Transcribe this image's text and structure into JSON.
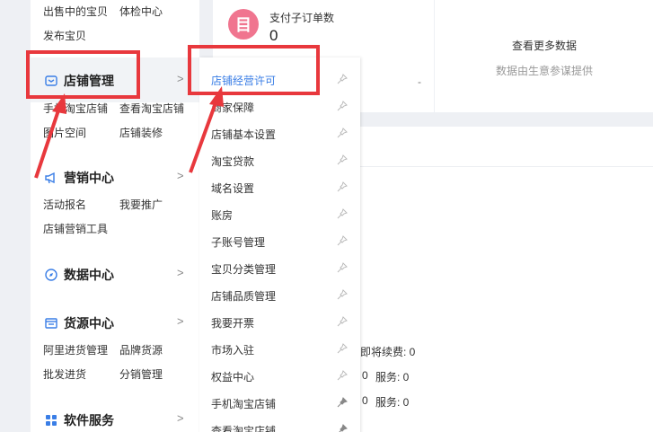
{
  "sidebar": {
    "top_links": [
      "出售中的宝贝",
      "体检中心",
      "发布宝贝"
    ],
    "shop": {
      "title": "店铺管理",
      "links": [
        "手机淘宝店铺",
        "查看淘宝店铺",
        "图片空间",
        "店铺装修"
      ]
    },
    "marketing": {
      "title": "营销中心",
      "links": [
        "活动报名",
        "我要推广",
        "店铺营销工具"
      ]
    },
    "data": {
      "title": "数据中心"
    },
    "supply": {
      "title": "货源中心",
      "links": [
        "阿里进货管理",
        "品牌货源",
        "批发进货",
        "分销管理"
      ]
    },
    "software": {
      "title": "软件服务"
    }
  },
  "flyout": {
    "items": [
      "店铺经营许可",
      "商家保障",
      "店铺基本设置",
      "淘宝贷款",
      "域名设置",
      "账房",
      "子账号管理",
      "宝贝分类管理",
      "店铺品质管理",
      "我要开票",
      "市场入驻",
      "权益中心",
      "手机淘宝店铺",
      "查看淘宝店铺"
    ]
  },
  "stats": {
    "badge_char": "目",
    "label": "支付子订单数",
    "value": "0",
    "dash": "-"
  },
  "more": {
    "title": "查看更多数据",
    "sub": "数据由生意参谋提供"
  },
  "info": {
    "line1": "即将续费: 0",
    "line2_num": "0",
    "line2_service": "服务: 0",
    "line3_num": "0",
    "line3_service": "服务: 0"
  },
  "colors": {
    "accent": "#3a7ee6",
    "annotation": "#e8383d",
    "badge": "#f0758f"
  }
}
